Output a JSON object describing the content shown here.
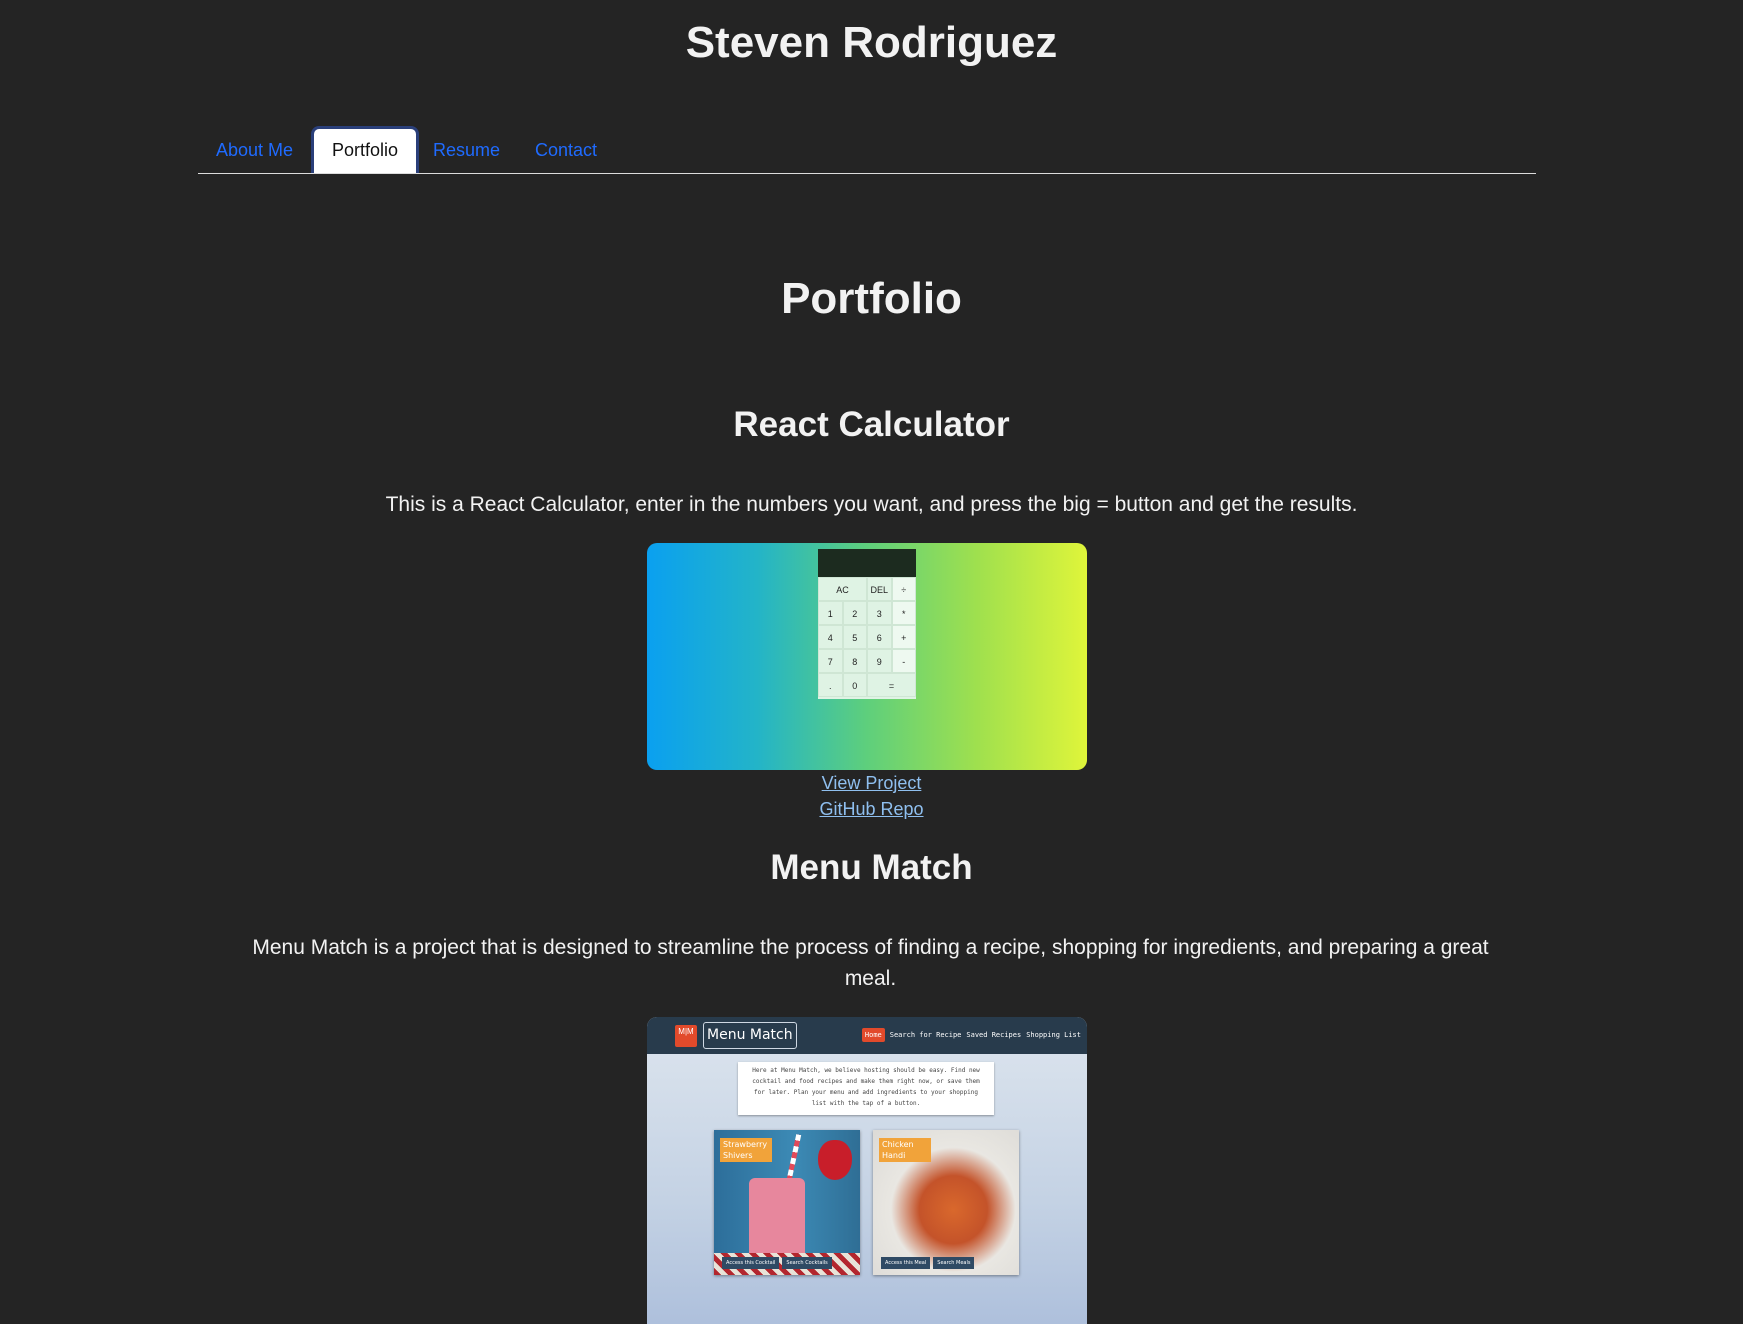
{
  "header": {
    "name": "Steven Rodriguez"
  },
  "nav": {
    "tabs": [
      {
        "label": "About Me",
        "active": false
      },
      {
        "label": "Portfolio",
        "active": true
      },
      {
        "label": "Resume",
        "active": false
      },
      {
        "label": "Contact",
        "active": false
      }
    ]
  },
  "page": {
    "title": "Portfolio"
  },
  "projects": [
    {
      "title": "React Calculator",
      "description": "This is a React Calculator, enter in the numbers you want, and press the big = button and get the results.",
      "view_link": "View Project",
      "repo_link": "GitHub Repo",
      "preview": {
        "keys": [
          "AC",
          "DEL",
          "÷",
          "1",
          "2",
          "3",
          "*",
          "4",
          "5",
          "6",
          "+",
          "7",
          "8",
          "9",
          "-",
          ".",
          "0",
          "="
        ]
      }
    },
    {
      "title": "Menu Match",
      "description": "Menu Match is a project that is designed to streamline the process of finding a recipe, shopping for ingredients, and preparing a great meal.",
      "preview": {
        "logo": "M|M",
        "brand": "Menu Match",
        "nav": [
          "Home",
          "Search for Recipe",
          "Saved Recipes",
          "Shopping List"
        ],
        "intro": "Here at Menu Match, we believe hosting should be easy. Find new cocktail and food recipes and make them right now, or save them for later. Plan your menu and add ingredients to your shopping list with the tap of a button.",
        "cards": [
          {
            "label": "Strawberry Shivers",
            "buttons": [
              "Access this Cocktail",
              "Search Cocktails"
            ]
          },
          {
            "label": "Chicken Handi",
            "buttons": [
              "Access this Meal",
              "Search Meals"
            ]
          }
        ]
      }
    }
  ],
  "colors": {
    "background": "#242424",
    "link": "#1f6bff",
    "project_link": "#8fbfef",
    "text": "#f2f2f2"
  }
}
